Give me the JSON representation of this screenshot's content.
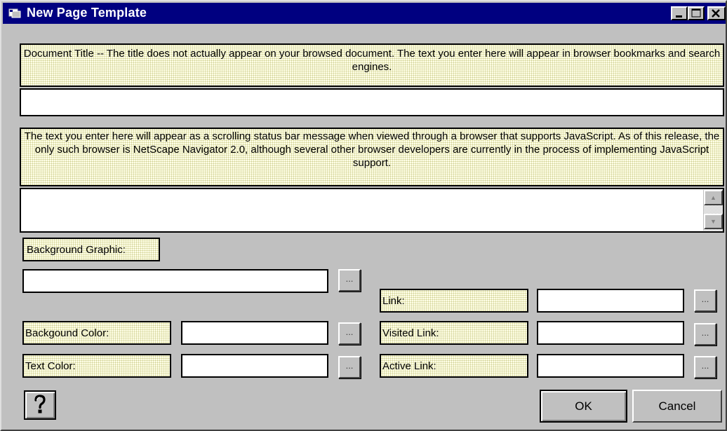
{
  "window": {
    "title": "New Page Template"
  },
  "document_title": {
    "description": "Document Title -- The title does not actually appear on your browsed document.  The text you enter here will appear in browser bookmarks and search engines.",
    "value": ""
  },
  "status_message": {
    "description": "The text you enter here will appear as a scrolling status bar message when viewed through a browser that supports JavaScript.  As of this release, the only such browser is NetScape Navigator 2.0, although several other browser developers are currently in the process of implementing JavaScript support.",
    "value": ""
  },
  "background_graphic": {
    "label": "Background Graphic:",
    "value": "",
    "browse_label": "..."
  },
  "background_color": {
    "label": "Backgound Color:",
    "value": "",
    "browse_label": "..."
  },
  "text_color": {
    "label": "Text Color:",
    "value": "",
    "browse_label": "..."
  },
  "link": {
    "label": "Link:",
    "value": "",
    "browse_label": "..."
  },
  "visited_link": {
    "label": "Visited Link:",
    "value": "",
    "browse_label": "..."
  },
  "active_link": {
    "label": "Active Link:",
    "value": "",
    "browse_label": "..."
  },
  "buttons": {
    "help_icon": "question-mark-icon",
    "ok": "OK",
    "cancel": "Cancel"
  },
  "colors": {
    "titlebar": "#000080",
    "face": "#c0c0c0",
    "label_bg": "#ffffe8"
  }
}
